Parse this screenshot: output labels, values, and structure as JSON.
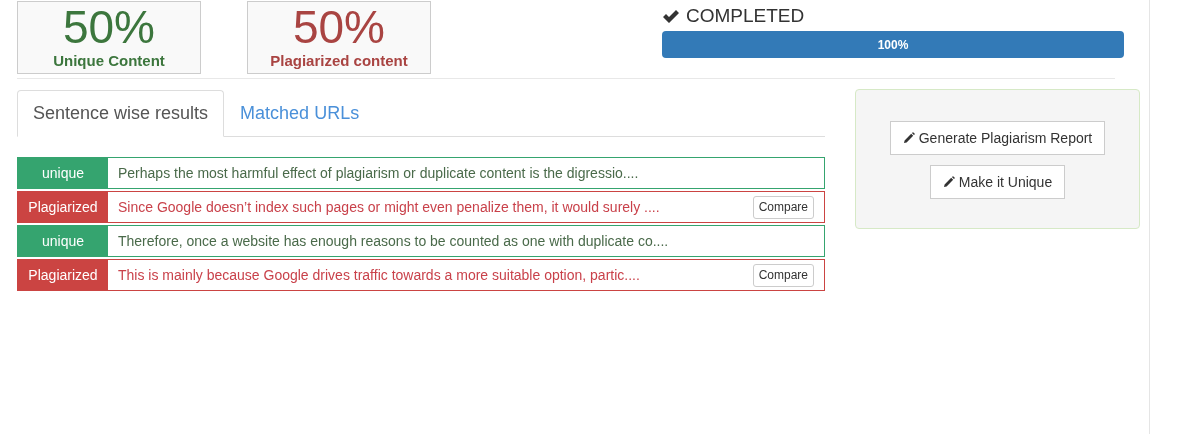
{
  "stats": [
    {
      "kind": "unique",
      "value": "50%",
      "label": "Unique Content"
    },
    {
      "kind": "plagiarized",
      "value": "50%",
      "label": "Plagiarized content"
    }
  ],
  "status": {
    "label": "COMPLETED",
    "progress": {
      "level": 1,
      "reading": "100%"
    }
  },
  "tabs": [
    {
      "label": "Sentence wise results",
      "selected": true
    },
    {
      "label": "Matched URLs",
      "selected": false
    }
  ],
  "results": [
    {
      "kind": "unique",
      "tag": "unique",
      "text": "Perhaps the most harmful effect of plagiarism or duplicate content is the digressio...."
    },
    {
      "kind": "plagiarized",
      "tag": "Plagiarized",
      "text": "Since Google doesn’t index such pages or might even penalize them, it would surely ....",
      "action": "Compare"
    },
    {
      "kind": "unique",
      "tag": "unique",
      "text": "Therefore, once a website has enough reasons to be counted as one with duplicate co...."
    },
    {
      "kind": "plagiarized",
      "tag": "Plagiarized",
      "text": "This is mainly because Google drives traffic towards a more suitable option, partic....",
      "action": "Compare"
    }
  ],
  "actions": [
    "Generate Plagiarism Report",
    "Make it Unique"
  ]
}
